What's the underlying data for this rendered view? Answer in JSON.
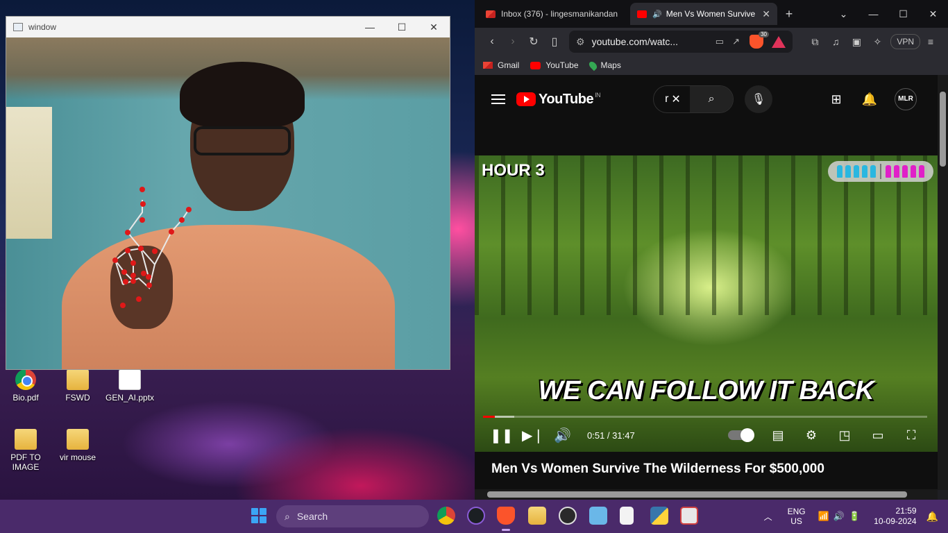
{
  "desktop": {
    "icons": [
      {
        "label": "Bio.pdf"
      },
      {
        "label": "FSWD"
      },
      {
        "label": "GEN_AI.pptx"
      },
      {
        "label": "PDF TO IMAGE"
      },
      {
        "label": "vir mouse"
      }
    ]
  },
  "camera_window": {
    "title": "window",
    "minimize": "—",
    "maximize": "☐",
    "close": "✕"
  },
  "browser": {
    "tabs": [
      {
        "label": "Inbox (376) - lingesmanikandan",
        "active": false
      },
      {
        "label": "Men Vs Women Survive",
        "active": true
      }
    ],
    "new_tab": "+",
    "window_controls": {
      "dropdown": "⌄",
      "minimize": "—",
      "maximize": "☐",
      "close": "✕"
    },
    "url": "youtube.com/watc...",
    "shield_count": "30",
    "vpn_label": "VPN",
    "bookmarks": [
      "Gmail",
      "YouTube",
      "Maps"
    ]
  },
  "youtube": {
    "logo_text": "YouTube",
    "country": "IN",
    "search_query": "r",
    "video": {
      "hour_label": "HOUR 3",
      "caption": "WE CAN FOLLOW IT BACK",
      "time_current": "0:51",
      "time_total": "31:47",
      "time_display": "0:51 / 31:47",
      "played_fraction": 0.027,
      "buffered_fraction": 0.07,
      "title": "Men Vs Women Survive The Wilderness For $500,000"
    },
    "counter": {
      "men": 5,
      "women": 5,
      "men_color": "#2ab7e0",
      "women_color": "#e020c8"
    },
    "avatar_text": "MLR"
  },
  "taskbar": {
    "search_placeholder": "Search",
    "language": "ENG",
    "region": "US",
    "time": "21:59",
    "date": "10-09-2024"
  },
  "colors": {
    "taskbar": "#4a2a6a",
    "youtube_red": "#ff0000",
    "browser_bg": "#1f1f23",
    "landmark": "#e01818"
  }
}
